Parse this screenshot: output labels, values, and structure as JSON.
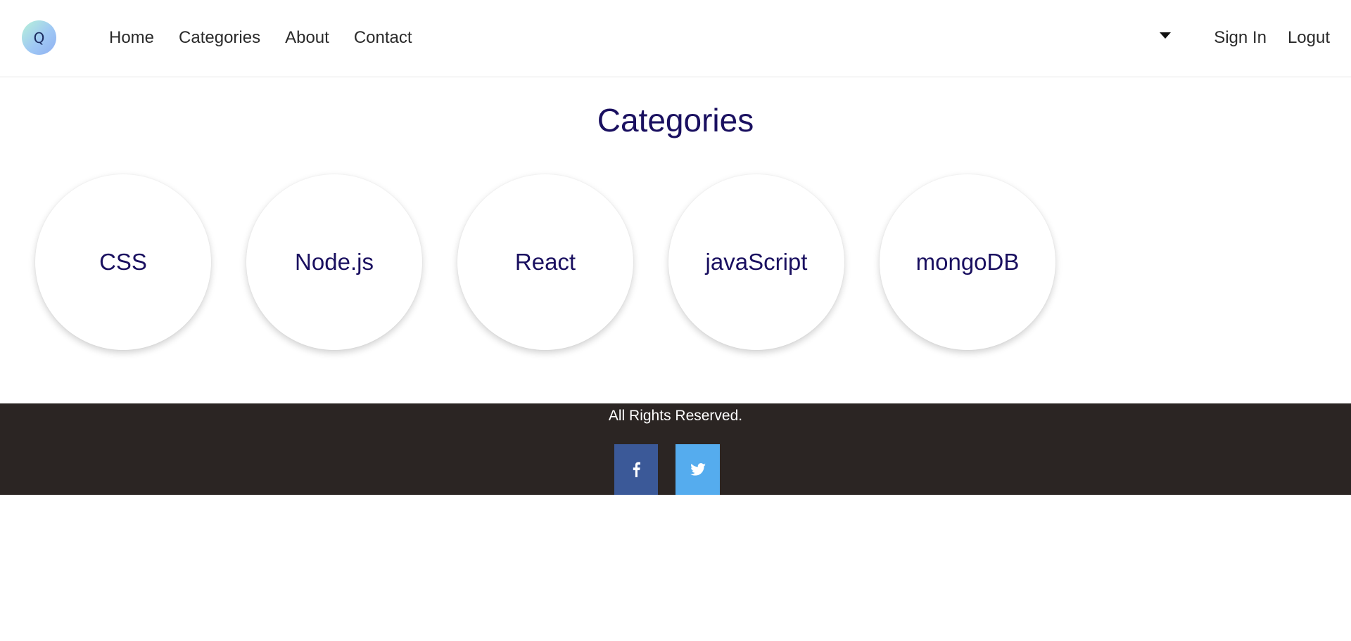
{
  "header": {
    "logo_letter": "Q",
    "nav": [
      {
        "label": "Home"
      },
      {
        "label": "Categories"
      },
      {
        "label": "About"
      },
      {
        "label": "Contact"
      }
    ],
    "dropdown_icon": "caret-down-icon",
    "auth": {
      "sign_in": "Sign In",
      "logout": "Logut"
    }
  },
  "main": {
    "title": "Categories",
    "categories": [
      {
        "label": "CSS"
      },
      {
        "label": "Node.js"
      },
      {
        "label": "React"
      },
      {
        "label": "javaScript"
      },
      {
        "label": "mongoDB"
      }
    ]
  },
  "footer": {
    "text": "All Rights Reserved.",
    "social": [
      {
        "icon": "facebook-icon",
        "color": "#3b5998"
      },
      {
        "icon": "twitter-icon",
        "color": "#55acee"
      }
    ],
    "background": "#2b2523"
  },
  "colors": {
    "title": "#1a1060",
    "nav_text": "#2a2a2a"
  }
}
